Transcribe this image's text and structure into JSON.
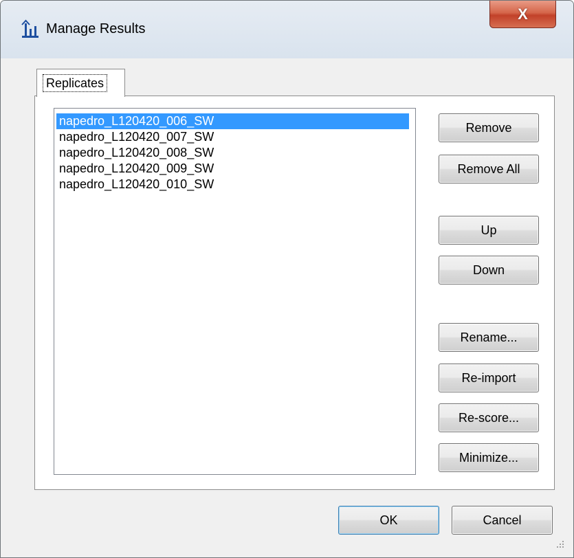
{
  "window": {
    "title": "Manage Results",
    "close_label": "X"
  },
  "tabs": [
    {
      "label": "Replicates"
    }
  ],
  "replicates": {
    "items": [
      "napedro_L120420_006_SW",
      "napedro_L120420_007_SW",
      "napedro_L120420_008_SW",
      "napedro_L120420_009_SW",
      "napedro_L120420_010_SW"
    ],
    "selected": "napedro_L120420_006_SW"
  },
  "buttons": {
    "remove": "Remove",
    "remove_all": "Remove All",
    "up": "Up",
    "down": "Down",
    "rename": "Rename...",
    "reimport": "Re-import",
    "rescore": "Re-score...",
    "minimize": "Minimize...",
    "ok": "OK",
    "cancel": "Cancel"
  },
  "colors": {
    "selection": "#3399ff",
    "close_button": "#c8482d",
    "window_background": "#f0f0f0"
  },
  "icons": {
    "app": "results-chart-icon",
    "close": "close-icon",
    "resize": "resize-grip-icon"
  }
}
